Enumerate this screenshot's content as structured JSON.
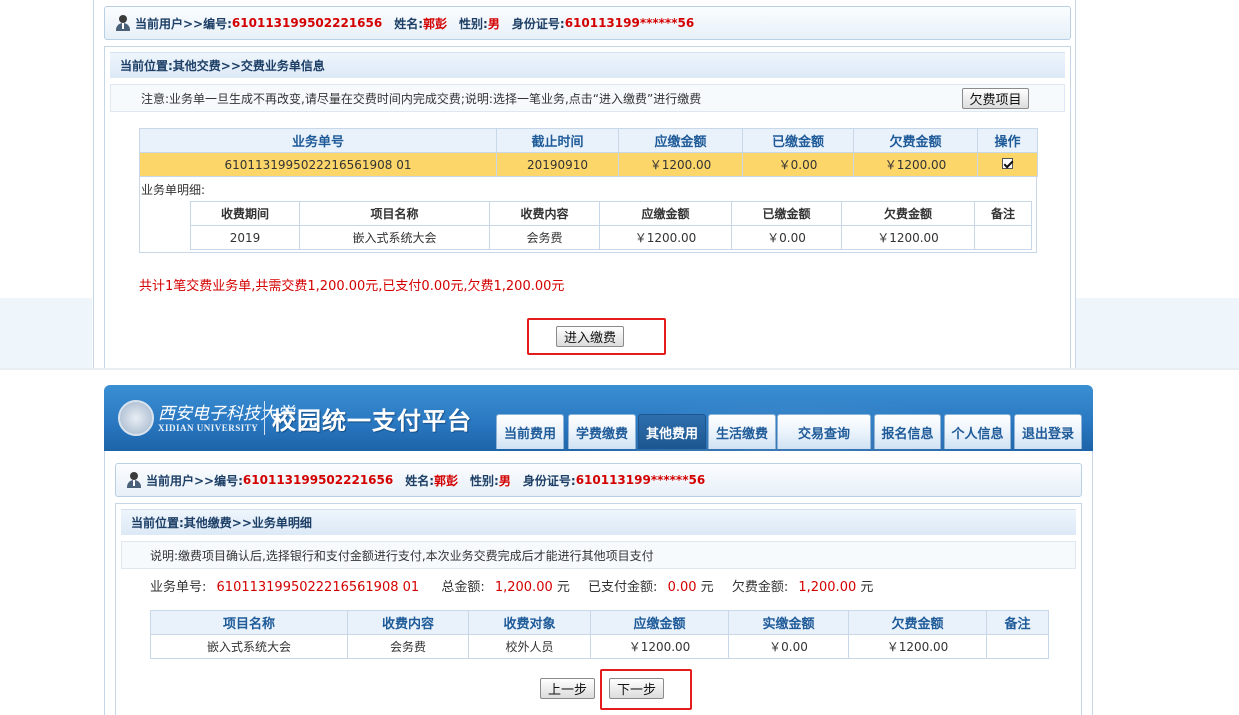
{
  "user": {
    "current_user_label": "当前用户>>编号:",
    "id": "610113199502221656",
    "name_label": "姓名:",
    "name": "郭彭",
    "gender_label": "性别:",
    "gender": "男",
    "idcard_label": "身份证号:",
    "idcard": "610113199******56"
  },
  "top": {
    "location": "当前位置:其他交费>>交费业务单信息",
    "notice": "注意:业务单一旦生成不再改变,请尽量在交费时间内完成交费;说明:选择一笔业务,点击“进入缴费”进行缴费",
    "arrears_button": "欠费项目",
    "order_table": {
      "headers": [
        "业务单号",
        "截止时间",
        "应缴金额",
        "已缴金额",
        "欠费金额",
        "操作"
      ],
      "row": [
        "6101131995022216561908 01",
        "20190910",
        "￥1200.00",
        "￥0.00",
        "￥1200.00"
      ]
    },
    "detail_label": "业务单明细:",
    "detail_table": {
      "headers": [
        "收费期间",
        "项目名称",
        "收费内容",
        "应缴金额",
        "已缴金额",
        "欠费金额",
        "备注"
      ],
      "row": [
        "2019",
        "嵌入式系统大会",
        "会务费",
        "￥1200.00",
        "￥0.00",
        "￥1200.00",
        ""
      ]
    },
    "summary": "共计1笔交费业务单,共需交费1,200.00元,已支付0.00元,欠费1,200.00元",
    "enter_button": "进入缴费"
  },
  "header": {
    "logo_cn": "西安电子科技大学",
    "logo_en": "XIDIAN UNIVERSITY",
    "platform": "校园统一支付平台",
    "nav": [
      "当前费用",
      "学费缴费",
      "其他费用",
      "生活缴费",
      "交易查询",
      "报名信息",
      "个人信息",
      "退出登录"
    ]
  },
  "bottom": {
    "location": "当前位置:其他缴费>>业务单明细",
    "notice": "说明:缴费项目确认后,选择银行和支付金额进行支付,本次业务交费完成后才能进行其他项目支付",
    "order_no_label": "业务单号:",
    "order_no": "6101131995022216561908 01",
    "total_label": "总金额:",
    "total": "1,200.00",
    "paid_label": "已支付金额:",
    "paid": "0.00",
    "arrears_label": "欠费金额:",
    "arrears": "1,200.00",
    "unit": "元",
    "table": {
      "headers": [
        "项目名称",
        "收费内容",
        "收费对象",
        "应缴金额",
        "实缴金额",
        "欠费金额",
        "备注"
      ],
      "row": [
        "嵌入式系统大会",
        "会务费",
        "校外人员",
        "￥1200.00",
        "￥0.00",
        "￥1200.00",
        ""
      ]
    },
    "prev_button": "上一步",
    "next_button": "下一步"
  },
  "colors": {
    "accent_red": "#d40000",
    "header_blue": "#2a79c2",
    "highlight_row": "#fdd66a",
    "annotation_box": "#e41c1c"
  }
}
